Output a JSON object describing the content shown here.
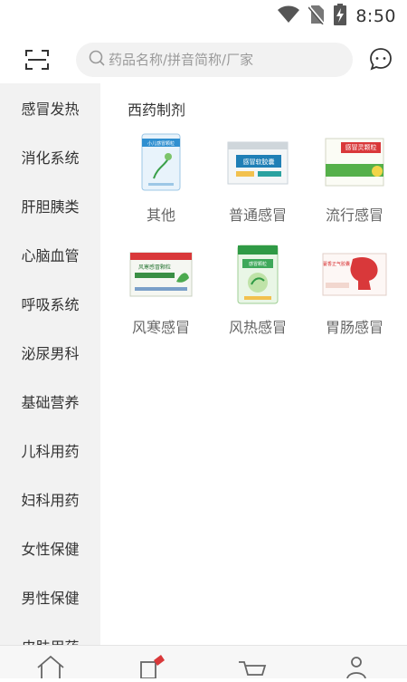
{
  "status": {
    "time": "8:50"
  },
  "search": {
    "placeholder": "药品名称/拼音简称/厂家"
  },
  "sidebar": {
    "items": [
      {
        "label": "感冒发热"
      },
      {
        "label": "消化系统"
      },
      {
        "label": "肝胆胰类"
      },
      {
        "label": "心脑血管"
      },
      {
        "label": "呼吸系统"
      },
      {
        "label": "泌尿男科"
      },
      {
        "label": "基础营养"
      },
      {
        "label": "儿科用药"
      },
      {
        "label": "妇科用药"
      },
      {
        "label": "女性保健"
      },
      {
        "label": "男性保健"
      },
      {
        "label": "皮肤用药"
      }
    ]
  },
  "main": {
    "section_title": "西药制剂",
    "products": [
      {
        "label": "其他",
        "package_text": "小儿感冒颗粒"
      },
      {
        "label": "普通感冒",
        "package_text": "感冒软胶囊"
      },
      {
        "label": "流行感冒",
        "package_text": "感冒灵颗粒"
      },
      {
        "label": "风寒感冒",
        "package_text": "风寒感冒颗粒"
      },
      {
        "label": "风热感冒",
        "package_text": "感冒颗粒"
      },
      {
        "label": "胃肠感冒",
        "package_text": "藿香正气胶囊"
      }
    ]
  },
  "colors": {
    "sidebar_bg": "#f2f2f2",
    "search_bg": "#f2f2f2",
    "accent_red": "#d9383a"
  },
  "tabbar": {
    "tabs": [
      {
        "icon": "home-icon"
      },
      {
        "icon": "category-icon"
      },
      {
        "icon": "cart-icon"
      },
      {
        "icon": "profile-icon"
      }
    ]
  }
}
